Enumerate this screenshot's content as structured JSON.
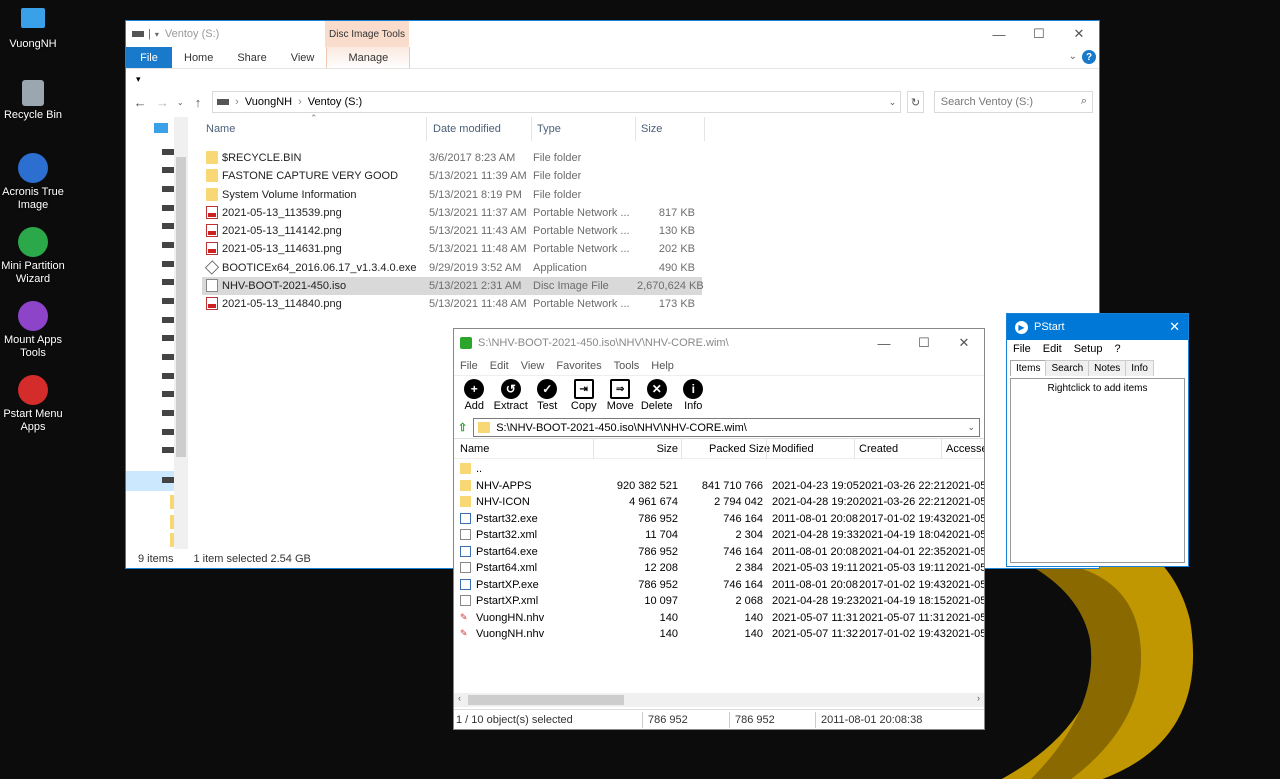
{
  "desktop": {
    "icons": [
      {
        "label": "VuongNH",
        "icon": "computer-icon"
      },
      {
        "label": "Recycle Bin",
        "icon": "recycle-bin-icon"
      },
      {
        "label": "Acronis True Image",
        "icon": "acronis-icon"
      },
      {
        "label": "Mini Partition Wizard",
        "icon": "partition-wizard-icon"
      },
      {
        "label": "Mount Apps Tools",
        "icon": "mount-apps-icon"
      },
      {
        "label": "Pstart Menu Apps",
        "icon": "pstart-icon"
      }
    ]
  },
  "explorer": {
    "title": "Ventoy (S:)",
    "context_tab_header": "Disc Image Tools",
    "tabs": [
      "File",
      "Home",
      "Share",
      "View",
      "Manage"
    ],
    "breadcrumb": [
      "VuongNH",
      "Ventoy (S:)"
    ],
    "search_placeholder": "Search Ventoy (S:)",
    "columns": {
      "name": "Name",
      "date": "Date modified",
      "type": "Type",
      "size": "Size"
    },
    "files": [
      {
        "name": "$RECYCLE.BIN",
        "date": "3/6/2017 8:23 AM",
        "type": "File folder",
        "size": "",
        "icon": "folder"
      },
      {
        "name": "FASTONE CAPTURE VERY GOOD",
        "date": "5/13/2021 11:39 AM",
        "type": "File folder",
        "size": "",
        "icon": "folder"
      },
      {
        "name": "System Volume Information",
        "date": "5/13/2021 8:19 PM",
        "type": "File folder",
        "size": "",
        "icon": "folder"
      },
      {
        "name": "2021-05-13_113539.png",
        "date": "5/13/2021 11:37 AM",
        "type": "Portable Network ...",
        "size": "817 KB",
        "icon": "png"
      },
      {
        "name": "2021-05-13_114142.png",
        "date": "5/13/2021 11:43 AM",
        "type": "Portable Network ...",
        "size": "130 KB",
        "icon": "png"
      },
      {
        "name": "2021-05-13_114631.png",
        "date": "5/13/2021 11:48 AM",
        "type": "Portable Network ...",
        "size": "202 KB",
        "icon": "png"
      },
      {
        "name": "BOOTICEx64_2016.06.17_v1.3.4.0.exe",
        "date": "9/29/2019 3:52 AM",
        "type": "Application",
        "size": "490 KB",
        "icon": "exe"
      },
      {
        "name": "NHV-BOOT-2021-450.iso",
        "date": "5/13/2021 2:31 AM",
        "type": "Disc Image File",
        "size": "2,670,624 KB",
        "icon": "iso",
        "selected": true
      },
      {
        "name": "2021-05-13_114840.png",
        "date": "5/13/2021 11:48 AM",
        "type": "Portable Network ...",
        "size": "173 KB",
        "icon": "png"
      }
    ],
    "status_count": "9 items",
    "status_selected": "1 item selected  2.54 GB"
  },
  "archive": {
    "title": "S:\\NHV-BOOT-2021-450.iso\\NHV\\NHV-CORE.wim\\",
    "menu": [
      "File",
      "Edit",
      "View",
      "Favorites",
      "Tools",
      "Help"
    ],
    "toolbar": [
      {
        "label": "Add",
        "icon": "add-icon",
        "glyph": "+"
      },
      {
        "label": "Extract",
        "icon": "extract-icon",
        "glyph": "↺"
      },
      {
        "label": "Test",
        "icon": "test-icon",
        "glyph": "✓"
      },
      {
        "label": "Copy",
        "icon": "copy-icon",
        "glyph": "⇥"
      },
      {
        "label": "Move",
        "icon": "move-icon",
        "glyph": "⇒"
      },
      {
        "label": "Delete",
        "icon": "delete-icon",
        "glyph": "✕"
      },
      {
        "label": "Info",
        "icon": "info-icon",
        "glyph": "i"
      }
    ],
    "path": "S:\\NHV-BOOT-2021-450.iso\\NHV\\NHV-CORE.wim\\",
    "columns": {
      "name": "Name",
      "size": "Size",
      "packed": "Packed Size",
      "modified": "Modified",
      "created": "Created",
      "accessed": "Accesse"
    },
    "rows": [
      {
        "name": "..",
        "size": "",
        "packed": "",
        "modified": "",
        "created": "",
        "accessed": "",
        "icon": "folder"
      },
      {
        "name": "NHV-APPS",
        "size": "920 382 521",
        "packed": "841 710 766",
        "modified": "2021-04-23 19:05",
        "created": "2021-03-26 22:21",
        "accessed": "2021-05-",
        "icon": "folder"
      },
      {
        "name": "NHV-ICON",
        "size": "4 961 674",
        "packed": "2 794 042",
        "modified": "2021-04-28 19:20",
        "created": "2021-03-26 22:21",
        "accessed": "2021-05-",
        "icon": "folder"
      },
      {
        "name": "Pstart32.exe",
        "size": "786 952",
        "packed": "746 164",
        "modified": "2011-08-01 20:08",
        "created": "2017-01-02 19:43",
        "accessed": "2021-05-",
        "icon": "exe"
      },
      {
        "name": "Pstart32.xml",
        "size": "11 704",
        "packed": "2 304",
        "modified": "2021-04-28 19:33",
        "created": "2021-04-19 18:04",
        "accessed": "2021-05-",
        "icon": "xml"
      },
      {
        "name": "Pstart64.exe",
        "size": "786 952",
        "packed": "746 164",
        "modified": "2011-08-01 20:08",
        "created": "2021-04-01 22:35",
        "accessed": "2021-05-",
        "icon": "exe"
      },
      {
        "name": "Pstart64.xml",
        "size": "12 208",
        "packed": "2 384",
        "modified": "2021-05-03 19:11",
        "created": "2021-05-03 19:11",
        "accessed": "2021-05-",
        "icon": "xml"
      },
      {
        "name": "PstartXP.exe",
        "size": "786 952",
        "packed": "746 164",
        "modified": "2011-08-01 20:08",
        "created": "2017-01-02 19:43",
        "accessed": "2021-05-",
        "icon": "exe"
      },
      {
        "name": "PstartXP.xml",
        "size": "10 097",
        "packed": "2 068",
        "modified": "2021-04-28 19:23",
        "created": "2021-04-19 18:15",
        "accessed": "2021-05-",
        "icon": "xml"
      },
      {
        "name": "VuongHN.nhv",
        "size": "140",
        "packed": "140",
        "modified": "2021-05-07 11:31",
        "created": "2021-05-07 11:31",
        "accessed": "2021-05-",
        "icon": "nhv"
      },
      {
        "name": "VuongNH.nhv",
        "size": "140",
        "packed": "140",
        "modified": "2021-05-07 11:32",
        "created": "2017-01-02 19:43",
        "accessed": "2021-05-",
        "icon": "nhv"
      }
    ],
    "status": {
      "selected": "1 / 10 object(s) selected",
      "size": "786 952",
      "packed": "786 952",
      "modified": "2011-08-01 20:08:38"
    }
  },
  "pstart": {
    "title": "PStart",
    "menu": [
      "File",
      "Edit",
      "Setup",
      "?"
    ],
    "tabs": [
      "Items",
      "Search",
      "Notes",
      "Info"
    ],
    "hint": "Rightclick to add items"
  },
  "colors": {
    "accent": "#0078d7",
    "folder": "#f8d775",
    "selection": "#d9d9d9",
    "context_tab": "#f9dccb"
  }
}
